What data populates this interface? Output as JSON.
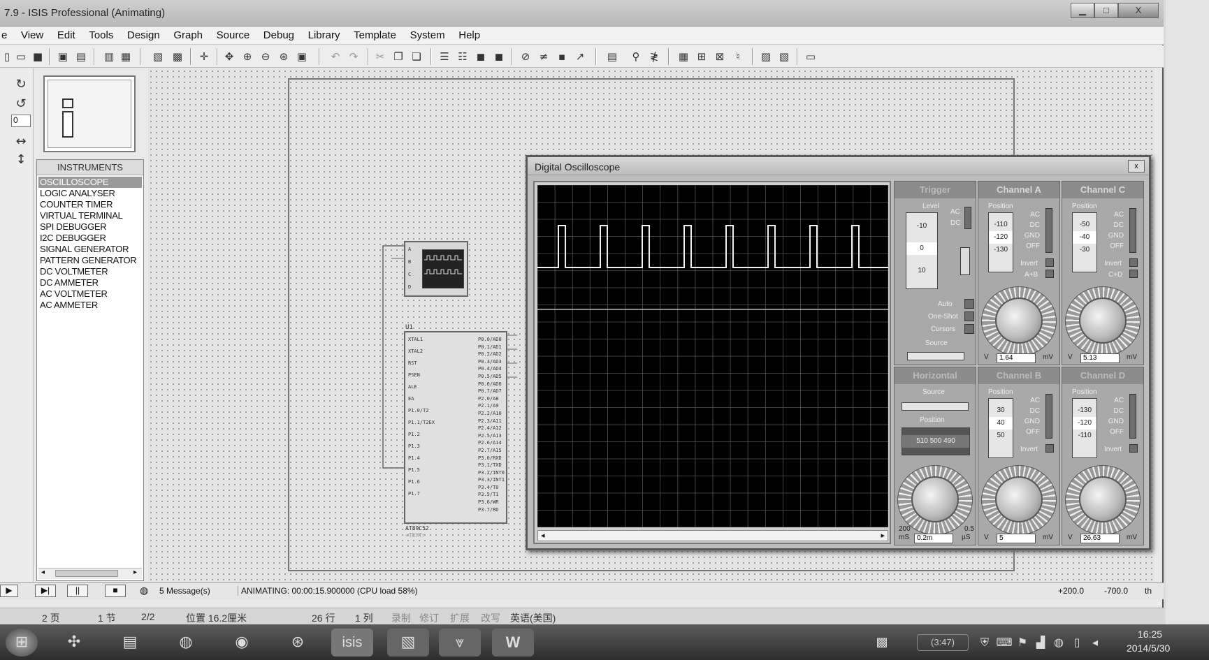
{
  "window": {
    "title": "7.9 - ISIS Professional (Animating)",
    "min": "▁",
    "max": "□",
    "close": "X"
  },
  "menu": [
    "e",
    "View",
    "Edit",
    "Tools",
    "Design",
    "Graph",
    "Source",
    "Debug",
    "Library",
    "Template",
    "System",
    "Help"
  ],
  "left_tools": {
    "rotate_value": "0"
  },
  "devices": {
    "header": "INSTRUMENTS",
    "items": [
      "OSCILLOSCOPE",
      "LOGIC ANALYSER",
      "COUNTER TIMER",
      "VIRTUAL TERMINAL",
      "SPI DEBUGGER",
      "I2C DEBUGGER",
      "SIGNAL GENERATOR",
      "PATTERN GENERATOR",
      "DC VOLTMETER",
      "DC AMMETER",
      "AC VOLTMETER",
      "AC AMMETER"
    ],
    "selected_index": 0
  },
  "schematic": {
    "scope_pins": [
      "A",
      "B",
      "C",
      "D"
    ],
    "chip_ref": "U1",
    "chip_left_pins": [
      "XTAL1",
      "XTAL2",
      "RST",
      "PSEN",
      "ALE",
      "EA",
      "P1.0/T2",
      "P1.1/T2EX",
      "P1.2",
      "P1.3",
      "P1.4",
      "P1.5",
      "P1.6",
      "P1.7"
    ],
    "chip_right_pins": [
      "P0.0/AD0",
      "P0.1/AD1",
      "P0.2/AD2",
      "P0.3/AD3",
      "P0.4/AD4",
      "P0.5/AD5",
      "P0.6/AD6",
      "P0.7/AD7",
      "P2.0/A8",
      "P2.1/A9",
      "P2.2/A10",
      "P2.3/A11",
      "P2.4/A12",
      "P2.5/A13",
      "P2.6/A14",
      "P2.7/A15",
      "P3.0/RXD",
      "P3.1/TXD",
      "P3.2/INT0",
      "P3.3/INT1",
      "P3.4/T0",
      "P3.5/T1",
      "P3.6/WR",
      "P3.7/RD"
    ],
    "chip_name": "AT89C52",
    "chip_sub": "<TEXT>"
  },
  "oscilloscope": {
    "title": "Digital Oscilloscope",
    "close": "x",
    "trigger": {
      "header": "Trigger",
      "level_label": "Level",
      "level_ticks": [
        "-10",
        "0",
        "10"
      ],
      "ac": "AC",
      "dc": "DC",
      "auto": "Auto",
      "oneshot": "One-Shot",
      "cursors": "Cursors",
      "source_label": "Source",
      "source_opts": [
        "A",
        "B",
        "C",
        "D"
      ]
    },
    "horizontal": {
      "header": "Horizontal",
      "source_label": "Source",
      "source_opts": [
        "A",
        "B",
        "C",
        "D"
      ],
      "position_label": "Position",
      "position_ticks": [
        "510",
        "500",
        "490"
      ],
      "dial_left": "mS",
      "dial_readout": "0.2m",
      "dial_right": "µS",
      "dial_min": "200",
      "dial_max": "0.5"
    },
    "channels": [
      {
        "header": "Channel A",
        "pos_ticks": [
          "-110",
          "-120",
          "-130"
        ],
        "readout": "1.64",
        "unit_left": "V",
        "unit_right": "mV",
        "extra": "A+B",
        "invert": "Invert"
      },
      {
        "header": "Channel C",
        "pos_ticks": [
          "-50",
          "-40",
          "-30"
        ],
        "readout": "5.13",
        "unit_left": "V",
        "unit_right": "mV",
        "extra": "C+D",
        "invert": "Invert"
      },
      {
        "header": "Channel B",
        "pos_ticks": [
          "30",
          "40",
          "50"
        ],
        "readout": "5",
        "unit_left": "V",
        "unit_right": "mV",
        "extra": "",
        "invert": "Invert"
      },
      {
        "header": "Channel D",
        "pos_ticks": [
          "-130",
          "-120",
          "-110"
        ],
        "readout": "26.63",
        "unit_left": "V",
        "unit_right": "mV",
        "extra": "",
        "invert": "Invert"
      }
    ],
    "coupling": [
      "AC",
      "DC",
      "GND",
      "OFF"
    ],
    "position_label": "Position",
    "pulse_count": 8
  },
  "statusbar": {
    "messages": "5 Message(s)",
    "animating": "ANIMATING: 00:00:15.900000 (CPU load 58%)",
    "coord_x": "+200.0",
    "coord_y": "-700.0",
    "unit": "th"
  },
  "wordbar": {
    "page": "2 页",
    "section": "1 节",
    "pages": "2/2",
    "position": "位置 16.2厘米",
    "line": "26 行",
    "col": "1 列",
    "rec": "录制",
    "rev": "修订",
    "ext": "扩展",
    "ovr": "改写",
    "lang": "英语(美国)"
  },
  "taskbar": {
    "time": "16:25",
    "date": "2014/5/30",
    "badge": "(3:47)"
  }
}
